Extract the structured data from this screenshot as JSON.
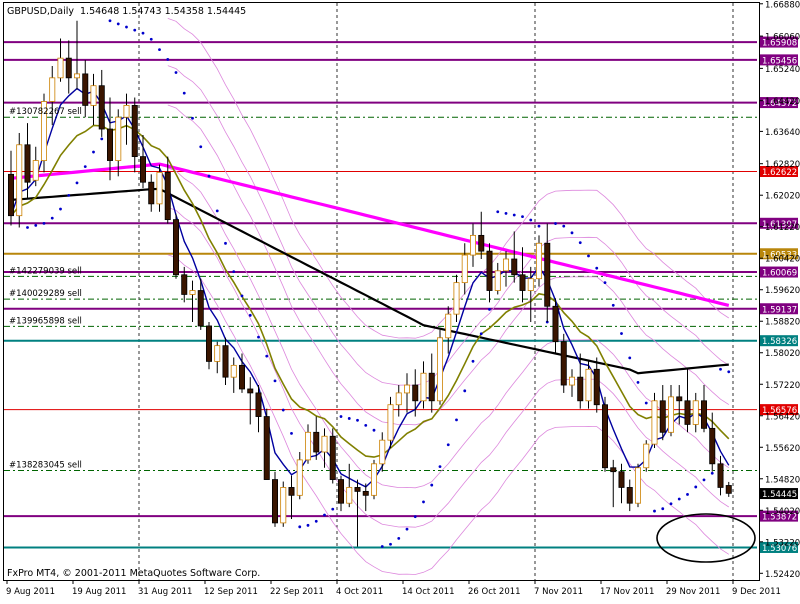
{
  "window": {
    "title": "GBPUSD,Daily",
    "ohlc": "1.54648 1.54743 1.54358 1.54445",
    "footer": "FxPro MT4, © 2001-2011 MetaQuotes Software Corp."
  },
  "chart_data": {
    "type": "candlestick",
    "symbol": "GBPUSD",
    "timeframe": "Daily",
    "ylim": [
      1.5225,
      1.669
    ],
    "y_ticks": [
      "1.66880",
      "1.66060",
      "1.65240",
      "1.64420",
      "1.63640",
      "1.62820",
      "1.62020",
      "1.61220",
      "1.60420",
      "1.59620",
      "1.58820",
      "1.58020",
      "1.57220",
      "1.56420",
      "1.55620",
      "1.54820",
      "1.54020",
      "1.53220",
      "1.52420"
    ],
    "x_labels": [
      "9 Aug 2011",
      "19 Aug 2011",
      "31 Aug 2011",
      "12 Sep 2011",
      "22 Sep 2011",
      "4 Oct 2011",
      "14 Oct 2011",
      "26 Oct 2011",
      "7 Nov 2011",
      "17 Nov 2011",
      "29 Nov 2011",
      "9 Dec 2011"
    ],
    "x_label_index": [
      0,
      8,
      16,
      24,
      32,
      40,
      48,
      56,
      64,
      72,
      80,
      88
    ],
    "vertical_separators": [
      16,
      40,
      64,
      88
    ],
    "current_price": "1.54445",
    "grid": false,
    "candles": [
      [
        1.6255,
        1.6315,
        1.6125,
        1.615
      ],
      [
        1.615,
        1.636,
        1.612,
        1.633
      ],
      [
        1.633,
        1.6385,
        1.6195,
        1.6235
      ],
      [
        1.624,
        1.6325,
        1.6225,
        1.629
      ],
      [
        1.629,
        1.646,
        1.626,
        1.644
      ],
      [
        1.644,
        1.653,
        1.638,
        1.65
      ],
      [
        1.65,
        1.66,
        1.649,
        1.655
      ],
      [
        1.655,
        1.6595,
        1.646,
        1.65
      ],
      [
        1.65,
        1.6645,
        1.647,
        1.651
      ],
      [
        1.651,
        1.6545,
        1.64,
        1.643
      ],
      [
        1.643,
        1.651,
        1.638,
        1.648
      ],
      [
        1.648,
        1.652,
        1.635,
        1.637
      ],
      [
        1.637,
        1.645,
        1.624,
        1.629
      ],
      [
        1.629,
        1.642,
        1.625,
        1.64
      ],
      [
        1.64,
        1.646,
        1.633,
        1.643
      ],
      [
        1.643,
        1.645,
        1.626,
        1.63
      ],
      [
        1.63,
        1.6355,
        1.622,
        1.6235
      ],
      [
        1.6235,
        1.6255,
        1.616,
        1.618
      ],
      [
        1.618,
        1.628,
        1.616,
        1.626
      ],
      [
        1.626,
        1.63,
        1.613,
        1.614
      ],
      [
        1.614,
        1.6155,
        1.599,
        1.6
      ],
      [
        1.6,
        1.602,
        1.593,
        1.595
      ],
      [
        1.595,
        1.5985,
        1.588,
        1.596
      ],
      [
        1.596,
        1.599,
        1.586,
        1.587
      ],
      [
        1.587,
        1.588,
        1.576,
        1.578
      ],
      [
        1.578,
        1.583,
        1.575,
        1.582
      ],
      [
        1.582,
        1.584,
        1.572,
        1.574
      ],
      [
        1.574,
        1.579,
        1.57,
        1.577
      ],
      [
        1.577,
        1.58,
        1.57,
        1.571
      ],
      [
        1.571,
        1.574,
        1.562,
        1.57
      ],
      [
        1.57,
        1.572,
        1.56,
        1.564
      ],
      [
        1.564,
        1.566,
        1.548,
        1.548
      ],
      [
        1.548,
        1.55,
        1.536,
        1.537
      ],
      [
        1.537,
        1.5475,
        1.536,
        1.546
      ],
      [
        1.546,
        1.549,
        1.538,
        1.544
      ],
      [
        1.544,
        1.555,
        1.543,
        1.553
      ],
      [
        1.553,
        1.562,
        1.552,
        1.56
      ],
      [
        1.56,
        1.564,
        1.553,
        1.555
      ],
      [
        1.555,
        1.561,
        1.551,
        1.559
      ],
      [
        1.559,
        1.561,
        1.547,
        1.548
      ],
      [
        1.548,
        1.549,
        1.54,
        1.542
      ],
      [
        1.542,
        1.552,
        1.541,
        1.546
      ],
      [
        1.546,
        1.548,
        1.531,
        1.545
      ],
      [
        1.545,
        1.547,
        1.54,
        1.544
      ],
      [
        1.544,
        1.553,
        1.543,
        1.552
      ],
      [
        1.552,
        1.56,
        1.55,
        1.558
      ],
      [
        1.558,
        1.569,
        1.556,
        1.567
      ],
      [
        1.567,
        1.572,
        1.564,
        1.57
      ],
      [
        1.57,
        1.575,
        1.565,
        1.572
      ],
      [
        1.572,
        1.576,
        1.564,
        1.568
      ],
      [
        1.568,
        1.578,
        1.566,
        1.575
      ],
      [
        1.575,
        1.58,
        1.565,
        1.568
      ],
      [
        1.568,
        1.586,
        1.567,
        1.584
      ],
      [
        1.584,
        1.592,
        1.58,
        1.59
      ],
      [
        1.59,
        1.6,
        1.588,
        1.598
      ],
      [
        1.598,
        1.608,
        1.595,
        1.605
      ],
      [
        1.605,
        1.613,
        1.602,
        1.61
      ],
      [
        1.61,
        1.616,
        1.604,
        1.606
      ],
      [
        1.606,
        1.608,
        1.593,
        1.596
      ],
      [
        1.596,
        1.603,
        1.595,
        1.601
      ],
      [
        1.601,
        1.606,
        1.597,
        1.604
      ],
      [
        1.604,
        1.611,
        1.598,
        1.6
      ],
      [
        1.6,
        1.607,
        1.593,
        1.596
      ],
      [
        1.596,
        1.602,
        1.588,
        1.599
      ],
      [
        1.599,
        1.61,
        1.597,
        1.608
      ],
      [
        1.608,
        1.613,
        1.588,
        1.592
      ],
      [
        1.592,
        1.594,
        1.58,
        1.583
      ],
      [
        1.583,
        1.585,
        1.57,
        1.572
      ],
      [
        1.572,
        1.576,
        1.569,
        1.574
      ],
      [
        1.574,
        1.58,
        1.566,
        1.568
      ],
      [
        1.568,
        1.578,
        1.566,
        1.576
      ],
      [
        1.576,
        1.579,
        1.565,
        1.567
      ],
      [
        1.567,
        1.569,
        1.55,
        1.551
      ],
      [
        1.551,
        1.553,
        1.541,
        1.55
      ],
      [
        1.55,
        1.552,
        1.542,
        1.546
      ],
      [
        1.546,
        1.548,
        1.54,
        1.542
      ],
      [
        1.542,
        1.552,
        1.541,
        1.551
      ],
      [
        1.551,
        1.558,
        1.55,
        1.557
      ],
      [
        1.557,
        1.57,
        1.556,
        1.568
      ],
      [
        1.568,
        1.572,
        1.558,
        1.56
      ],
      [
        1.56,
        1.572,
        1.559,
        1.569
      ],
      [
        1.569,
        1.572,
        1.562,
        1.568
      ],
      [
        1.568,
        1.576,
        1.56,
        1.562
      ],
      [
        1.562,
        1.57,
        1.56,
        1.568
      ],
      [
        1.568,
        1.572,
        1.56,
        1.561
      ],
      [
        1.561,
        1.565,
        1.55,
        1.552
      ],
      [
        1.552,
        1.554,
        1.544,
        1.546
      ],
      [
        1.5465,
        1.5474,
        1.5436,
        1.5445
      ]
    ],
    "horizontal_levels": [
      {
        "label": "1.65908",
        "price": 1.65908,
        "color": "#800080",
        "width": 2,
        "dash": ""
      },
      {
        "label": "1.65456",
        "price": 1.65456,
        "color": "#800080",
        "width": 2,
        "dash": ""
      },
      {
        "label": "1.64372",
        "price": 1.64372,
        "color": "#800080",
        "width": 2,
        "dash": ""
      },
      {
        "label": "",
        "price": 1.64,
        "color": "#006400",
        "width": 1,
        "dash": "6,3,2,3"
      },
      {
        "label": "1.62622",
        "price": 1.62622,
        "color": "#e00000",
        "width": 1,
        "dash": ""
      },
      {
        "label": "1.61307",
        "price": 1.61307,
        "color": "#800080",
        "width": 2,
        "dash": ""
      },
      {
        "label": "1.60533",
        "price": 1.60533,
        "color": "#b8860b",
        "width": 2,
        "dash": ""
      },
      {
        "label": "1.60069",
        "price": 1.60069,
        "color": "#800080",
        "width": 2,
        "dash": ""
      },
      {
        "label": "",
        "price": 1.5996,
        "color": "#006400",
        "width": 1,
        "dash": "6,3,2,3"
      },
      {
        "label": "",
        "price": 1.5938,
        "color": "#006400",
        "width": 1,
        "dash": "6,3,2,3"
      },
      {
        "label": "1.59137",
        "price": 1.59137,
        "color": "#800080",
        "width": 2,
        "dash": ""
      },
      {
        "label": "",
        "price": 1.5869,
        "color": "#006400",
        "width": 1,
        "dash": "6,3,2,3"
      },
      {
        "label": "1.58326",
        "price": 1.58326,
        "color": "#008080",
        "width": 2,
        "dash": ""
      },
      {
        "label": "1.56576",
        "price": 1.56576,
        "color": "#e00000",
        "width": 1,
        "dash": ""
      },
      {
        "label": "",
        "price": 1.5503,
        "color": "#006400",
        "width": 1,
        "dash": "6,3,2,3"
      },
      {
        "label": "1.53872",
        "price": 1.53872,
        "color": "#800080",
        "width": 2,
        "dash": ""
      },
      {
        "label": "1.53076",
        "price": 1.53076,
        "color": "#008080",
        "width": 2,
        "dash": ""
      }
    ],
    "trade_labels": [
      {
        "text": "#130782267 sell",
        "price": 1.64
      },
      {
        "text": "#142279039 sell",
        "price": 1.5996
      },
      {
        "text": "#140029289 sell",
        "price": 1.5938
      },
      {
        "text": "#139965898 sell",
        "price": 1.5869
      },
      {
        "text": "#138283045 sell",
        "price": 1.5503
      }
    ],
    "legend": ""
  }
}
